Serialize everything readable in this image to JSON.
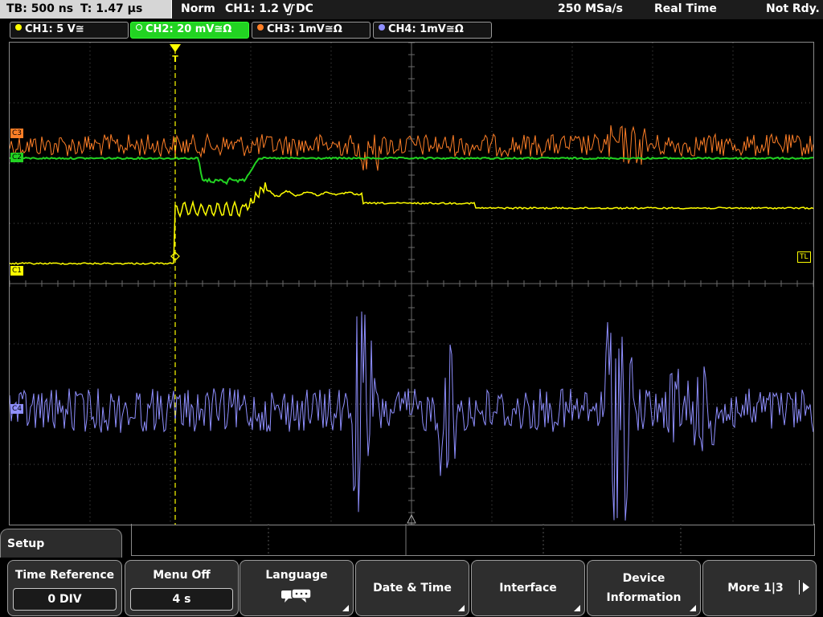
{
  "topbar": {
    "timebase": "TB: 500 ns",
    "trigger_time": "T: 1.47 µs",
    "mode": "Norm",
    "trigger_source": "CH1: 1.2 V",
    "trigger_coupling": "DC",
    "sample_rate": "250 MSa/s",
    "acquisition": "Real Time",
    "status": "Not Rdy."
  },
  "channels": [
    {
      "label": "CH1: 5 V≅",
      "color": "#ffff00",
      "active": false
    },
    {
      "label": "CH2: 20 mV≅Ω",
      "color": "#22d322",
      "active": true
    },
    {
      "label": "CH3: 1mV≅Ω",
      "color": "#ff7f27",
      "active": false
    },
    {
      "label": "CH4: 1mV≅Ω",
      "color": "#8f8fff",
      "active": false
    }
  ],
  "markers": {
    "c3": "C3",
    "c2": "C2",
    "c1": "C1",
    "c4": "C4",
    "tl": "TL",
    "trigger": "T"
  },
  "setup": {
    "title": "Setup"
  },
  "softkeys": [
    {
      "label": "Time Reference",
      "value": "0 DIV"
    },
    {
      "label": "Menu Off",
      "value": "4 s"
    },
    {
      "label": "Language",
      "icon": "speech-bubbles-icon"
    },
    {
      "label": "Date & Time"
    },
    {
      "label": "Interface"
    },
    {
      "label_line1": "Device",
      "label_line2": "Information"
    },
    {
      "label": "More 1|3"
    }
  ],
  "colors": {
    "ch1": "#ffff00",
    "ch2": "#22d322",
    "ch3": "#ff7f27",
    "ch4": "#8f8fff",
    "grid": "#555555"
  }
}
